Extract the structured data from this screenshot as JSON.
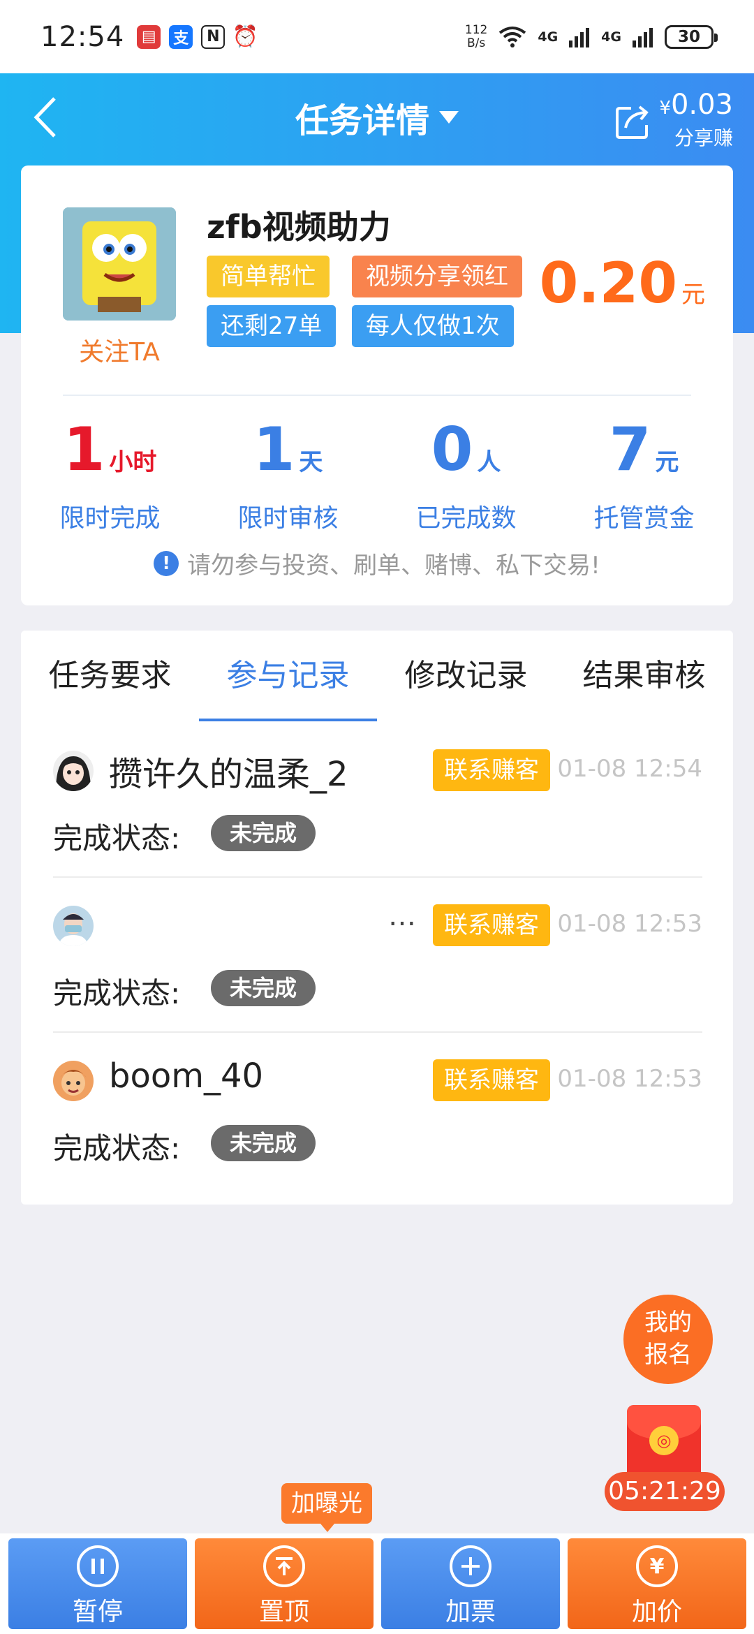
{
  "status_bar": {
    "time": "12:54",
    "speed_value": "112",
    "speed_unit": "B/s",
    "net1": "4G",
    "net2": "4G",
    "battery": "30"
  },
  "header": {
    "title": "任务详情",
    "share_currency": "¥",
    "share_amount": "0.03",
    "share_label": "分享赚"
  },
  "task": {
    "title": "zfb视频助力",
    "follow_label": "关注TA",
    "tags": [
      "简单帮忙",
      "视频分享领红",
      "还剩27单",
      "每人仅做1次"
    ],
    "price": "0.20",
    "price_unit": "元",
    "stats": [
      {
        "num": "1",
        "unit": "小时",
        "label": "限时完成"
      },
      {
        "num": "1",
        "unit": "天",
        "label": "限时审核"
      },
      {
        "num": "0",
        "unit": "人",
        "label": "已完成数"
      },
      {
        "num": "7",
        "unit": "元",
        "label": "托管赏金"
      }
    ],
    "notice": "请勿参与投资、刷单、赌博、私下交易!"
  },
  "tabs": [
    "任务要求",
    "参与记录",
    "修改记录",
    "结果审核"
  ],
  "active_tab": "参与记录",
  "records": [
    {
      "name": "攒许久的温柔_2",
      "contact": "联系赚客",
      "time": "01-08 12:54",
      "status_label": "完成状态:",
      "status": "未完成"
    },
    {
      "name": "",
      "more": "…",
      "contact": "联系赚客",
      "time": "01-08 12:53",
      "status_label": "完成状态:",
      "status": "未完成"
    },
    {
      "name": "boom_40",
      "contact": "联系赚客",
      "time": "01-08 12:53",
      "status_label": "完成状态:",
      "status": "未完成"
    }
  ],
  "floating": {
    "my_signup_line1": "我的",
    "my_signup_line2": "报名",
    "timer": "05:21:29",
    "tip": "加曝光"
  },
  "bottom": [
    {
      "label": "暂停",
      "icon": "pause-icon"
    },
    {
      "label": "置顶",
      "icon": "pin-top-icon"
    },
    {
      "label": "加票",
      "icon": "plus-icon"
    },
    {
      "label": "加价",
      "icon": "raise-price-icon"
    }
  ],
  "colors": {
    "primary_blue": "#3b7fe4",
    "orange": "#ff6a1a",
    "yellow_tag": "#f9c82c",
    "orange_tag": "#f9834d",
    "contact": "#ffb711"
  }
}
